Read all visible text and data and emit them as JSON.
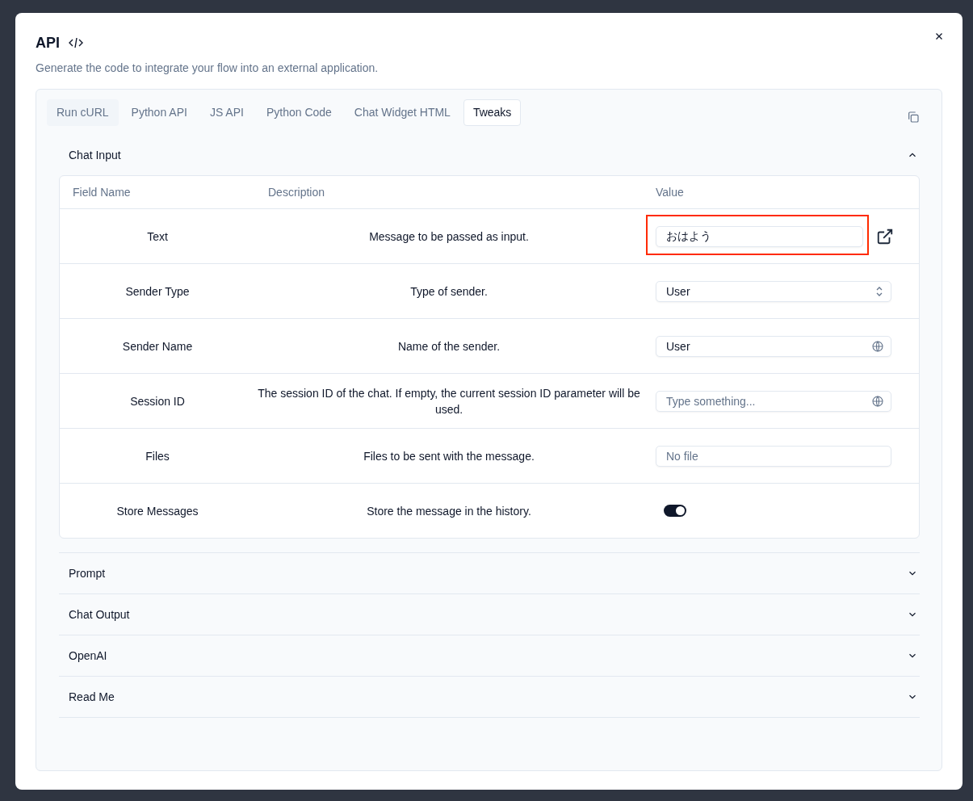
{
  "dialog": {
    "title": "API",
    "description": "Generate the code to integrate your flow into an external application."
  },
  "tabs": [
    {
      "label": "Run cURL",
      "selected": false
    },
    {
      "label": "Python API",
      "selected": false
    },
    {
      "label": "JS API",
      "selected": false
    },
    {
      "label": "Python Code",
      "selected": false
    },
    {
      "label": "Chat Widget HTML",
      "selected": false
    },
    {
      "label": "Tweaks",
      "selected": true
    }
  ],
  "sections": [
    {
      "title": "Chat Input",
      "expanded": true,
      "table": {
        "columns": [
          "Field Name",
          "Description",
          "Value"
        ],
        "rows": [
          {
            "field": "Text",
            "description": "Message to be passed as input.",
            "kind": "text",
            "value": "おはよう",
            "highlighted": true
          },
          {
            "field": "Sender Type",
            "description": "Type of sender.",
            "kind": "select",
            "value": "User",
            "highlighted": false
          },
          {
            "field": "Sender Name",
            "description": "Name of the sender.",
            "kind": "global",
            "value": "User",
            "highlighted": false
          },
          {
            "field": "Session ID",
            "description": "The session ID of the chat. If empty, the current session ID parameter will be used.",
            "kind": "global",
            "placeholder": "Type something...",
            "highlighted": false
          },
          {
            "field": "Files",
            "description": "Files to be sent with the message.",
            "kind": "file",
            "placeholder": "No file",
            "highlighted": false
          },
          {
            "field": "Store Messages",
            "description": "Store the message in the history.",
            "kind": "toggle",
            "on": true,
            "highlighted": false
          }
        ]
      }
    },
    {
      "title": "Prompt",
      "expanded": false
    },
    {
      "title": "Chat Output",
      "expanded": false
    },
    {
      "title": "OpenAI",
      "expanded": false
    },
    {
      "title": "Read Me",
      "expanded": false
    }
  ]
}
